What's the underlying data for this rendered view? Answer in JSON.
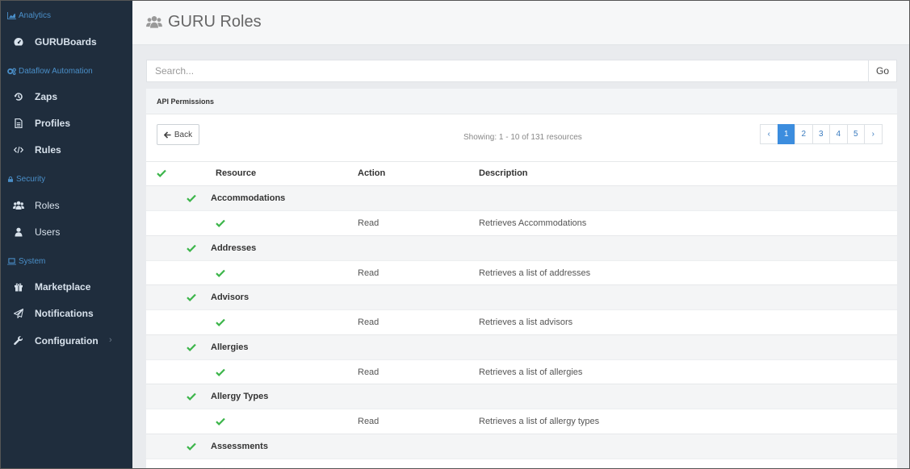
{
  "sidebar": {
    "sections": [
      {
        "label": "Analytics",
        "icon": "area-chart-icon"
      },
      {
        "label": "Dataflow Automation",
        "icon": "cogs-icon"
      },
      {
        "label": "Security",
        "icon": "lock-icon"
      },
      {
        "label": "System",
        "icon": "laptop-icon"
      }
    ],
    "items": [
      {
        "label": "GURUBoards",
        "icon": "tachometer-icon"
      },
      {
        "label": "Zaps",
        "icon": "history-icon"
      },
      {
        "label": "Profiles",
        "icon": "file-text-icon"
      },
      {
        "label": "Rules",
        "icon": "code-icon"
      },
      {
        "label": "Roles",
        "icon": "users-icon"
      },
      {
        "label": "Users",
        "icon": "user-icon"
      },
      {
        "label": "Marketplace",
        "icon": "gift-icon"
      },
      {
        "label": "Notifications",
        "icon": "paper-plane-icon"
      },
      {
        "label": "Configuration",
        "icon": "wrench-icon",
        "chevron": "›"
      }
    ]
  },
  "header": {
    "title": "GURU Roles",
    "icon": "users-icon"
  },
  "search": {
    "placeholder": "Search...",
    "go_label": "Go"
  },
  "card": {
    "title": "API Permissions",
    "back_label": "Back",
    "showing": "Showing: 1 - 10 of 131 resources",
    "pagination": {
      "prev": "‹",
      "pages": [
        "1",
        "2",
        "3",
        "4",
        "5"
      ],
      "active": "1",
      "next": "›"
    }
  },
  "table": {
    "columns": [
      "Resource",
      "Action",
      "Description"
    ],
    "groups": [
      {
        "name": "Accommodations",
        "items": [
          {
            "action": "Read",
            "description": "Retrieves Accommodations"
          }
        ]
      },
      {
        "name": "Addresses",
        "items": [
          {
            "action": "Read",
            "description": "Retrieves a list of addresses"
          }
        ]
      },
      {
        "name": "Advisors",
        "items": [
          {
            "action": "Read",
            "description": "Retrieves a list advisors"
          }
        ]
      },
      {
        "name": "Allergies",
        "items": [
          {
            "action": "Read",
            "description": "Retrieves a list of allergies"
          }
        ]
      },
      {
        "name": "Allergy Types",
        "items": [
          {
            "action": "Read",
            "description": "Retrieves a list of allergy types"
          }
        ]
      },
      {
        "name": "Assessments",
        "items": []
      }
    ]
  },
  "colors": {
    "sidebar_bg": "#1f2d3d",
    "section_label": "#4a8fc9",
    "check_green": "#3cb54a",
    "active_page": "#3c8dde"
  }
}
